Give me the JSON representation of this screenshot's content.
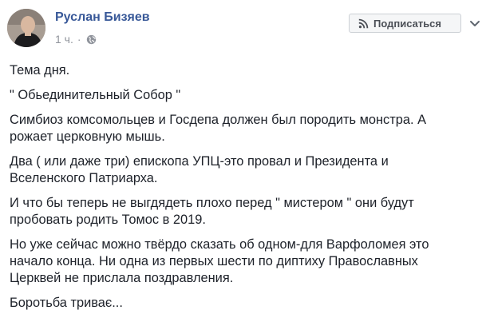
{
  "post": {
    "author_name": "Руслан Бизяев",
    "timestamp": "1 ч.",
    "separator": "·",
    "privacy_icon": "globe-icon",
    "subscribe_label": "Подписаться",
    "subscribe_icon": "rss-icon",
    "options_icon": "chevron-down-icon",
    "paragraphs": [
      "Тема дня.",
      "\" Обьединительный Собор \"",
      "Симбиоз комсомольцев и Госдепа должен был породить монстра. А рожает церковную мышь.",
      "Два ( или даже три) епископа УПЦ-это провал и Президента и Вселенского Патриарха.",
      "И что бы теперь не выгдядеть плохо перед \" мистером \" они будут пробовать родить Томос в 2019.",
      "Но уже сейчас можно твёрдо сказать об одном-для Варфоломея это начало конца. Ни одна из первых шести по диптиху Православных Церквей не прислала поздравления.",
      "Боротьба триває..."
    ]
  },
  "colors": {
    "author_link": "#385898",
    "meta_text": "#90949c",
    "body_text": "#1d2129",
    "button_bg": "#f5f6f7",
    "button_border": "#ccd0d5"
  }
}
